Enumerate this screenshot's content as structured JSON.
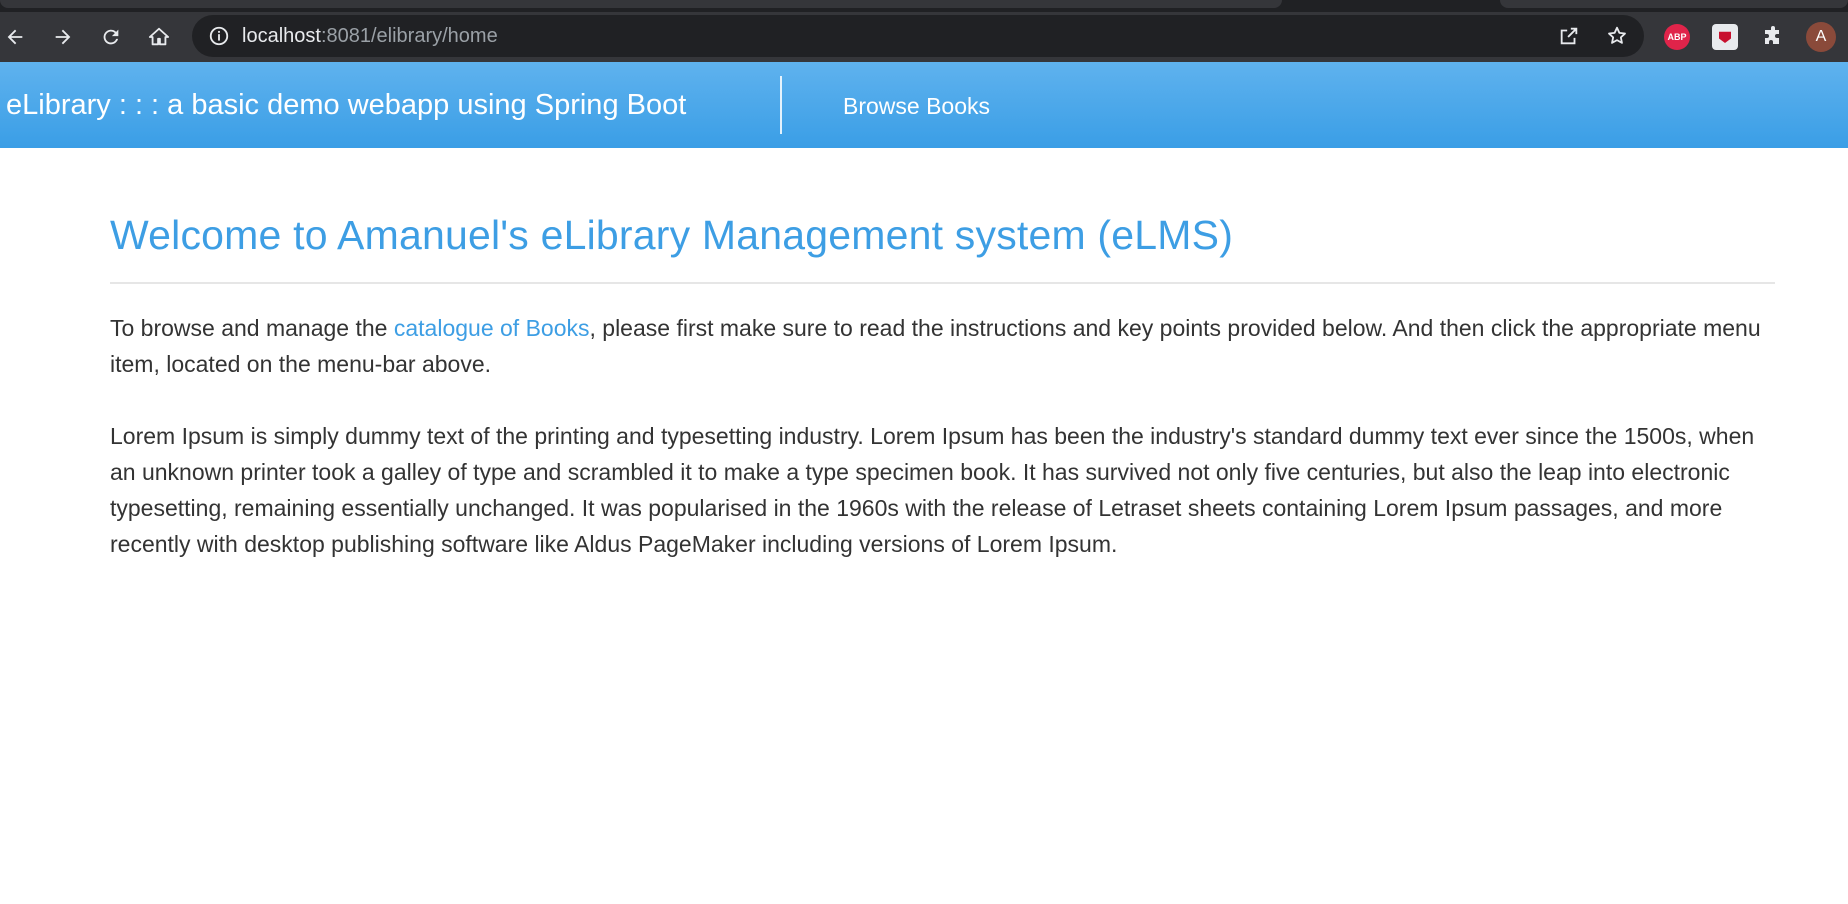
{
  "browser": {
    "url_host": "localhost",
    "url_rest": ":8081/elibrary/home",
    "extensions": {
      "abp_label": "ABP"
    },
    "avatar_letter": "A"
  },
  "navbar": {
    "brand": "eLibrary : : : a basic demo webapp using Spring Boot",
    "browse_books": "Browse Books"
  },
  "main": {
    "heading": "Welcome to Amanuel's eLibrary Management system (eLMS)",
    "intro_before": "To browse and manage the ",
    "intro_link": "catalogue of Books",
    "intro_after": ", please first make sure to read the instructions and key points provided below. And then click the appropriate menu item, located on the menu-bar above.",
    "lorem": "Lorem Ipsum is simply dummy text of the printing and typesetting industry. Lorem Ipsum has been the industry's standard dummy text ever since the 1500s, when an unknown printer took a galley of type and scrambled it to make a type specimen book. It has survived not only five centuries, but also the leap into electronic typesetting, remaining essentially unchanged. It was popularised in the 1960s with the release of Letraset sheets containing Lorem Ipsum passages, and more recently with desktop publishing software like Aldus PageMaker including versions of Lorem Ipsum."
  },
  "colors": {
    "navbar": "#4aa7ea",
    "accent": "#3d9ee4",
    "text": "#333333"
  }
}
